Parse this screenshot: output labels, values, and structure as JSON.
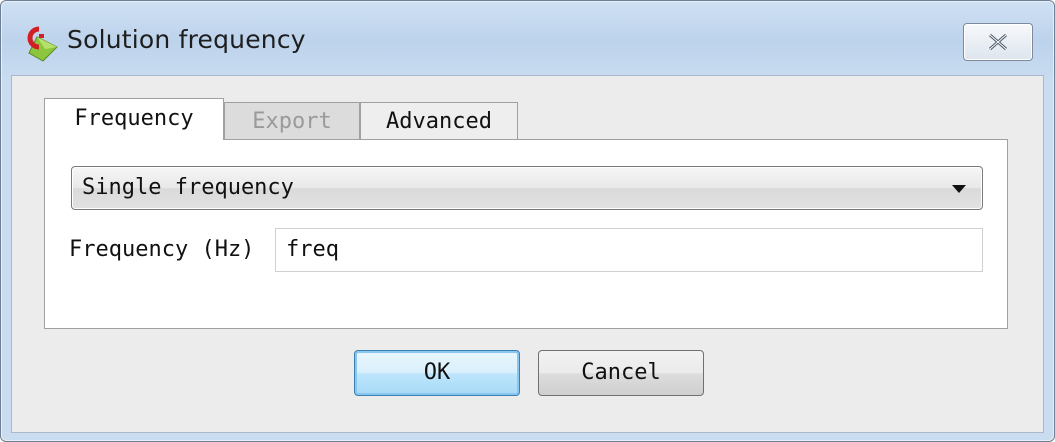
{
  "window": {
    "title": "Solution frequency",
    "app_icon": "comsol-app-icon",
    "close_icon": "close-icon"
  },
  "tabs": [
    {
      "label": "Frequency",
      "state": "active"
    },
    {
      "label": "Export",
      "state": "disabled"
    },
    {
      "label": "Advanced",
      "state": "inactive"
    }
  ],
  "frequency_tab": {
    "mode_select": {
      "value": "Single frequency",
      "icon": "chevron-down-icon"
    },
    "frequency_field": {
      "label": "Frequency (Hz)",
      "value": "freq"
    }
  },
  "buttons": {
    "ok": "OK",
    "cancel": "Cancel"
  },
  "colors": {
    "title_bar": "#bdd3ec",
    "focus_button": "#3c7fb1",
    "disabled_text": "#9a9a9a"
  }
}
